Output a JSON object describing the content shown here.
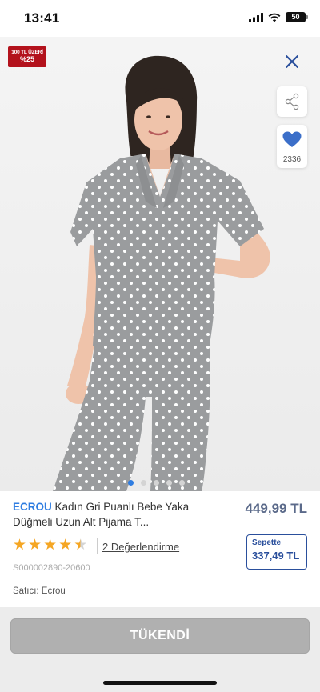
{
  "status_bar": {
    "time": "13:41",
    "battery": "50"
  },
  "product": {
    "promo_badge": {
      "line1": "100 TL ÜZERİ",
      "line2": "%25"
    },
    "favorite_count": "2336",
    "brand": "ECROU",
    "title": "Kadın Gri Puanlı Bebe Yaka Düğmeli Uzun Alt Pijama T...",
    "price": "449,99 TL",
    "basket": {
      "label": "Sepette",
      "price": "337,49 TL"
    },
    "rating_stars": 4.5,
    "reviews_text": "2 Değerlendirme",
    "sku": "S000002890-20600",
    "seller": "Satıcı: Ecrou"
  },
  "gallery": {
    "image_count": 5,
    "active_index": 1
  },
  "bottom": {
    "button_label": "TÜKENDİ"
  },
  "colors": {
    "brand_blue": "#2f7de1",
    "basket_blue": "#2a4f9c",
    "heart_blue": "#3b6fc9",
    "promo_red": "#b3121c",
    "soldout_gray": "#b0b0b0",
    "star_gold": "#f5a623"
  }
}
